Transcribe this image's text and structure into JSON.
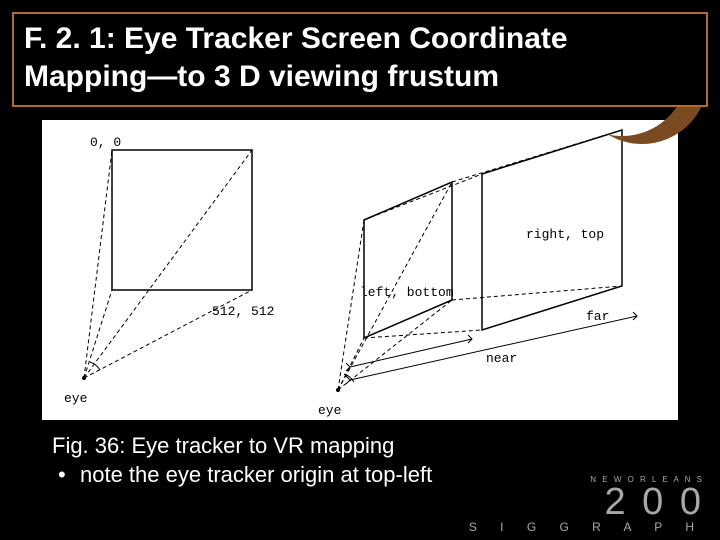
{
  "title": "F. 2. 1: Eye Tracker Screen Coordinate Mapping—to 3 D viewing frustum",
  "figure": {
    "left": {
      "origin_label": "0, 0",
      "extent_label": "512, 512",
      "eye_label": "eye"
    },
    "right": {
      "top_corner_label": "right, top",
      "bottom_corner_label": "left, bottom",
      "near_label": "near",
      "far_label": "far",
      "eye_label": "eye"
    }
  },
  "caption": {
    "line": "Fig. 36: Eye tracker to VR mapping",
    "bullet": "note the eye tracker origin at top-left"
  },
  "brand": {
    "city": "N E W   O R L E A N S",
    "year": "2 0 0 ",
    "name": "S I G G R A P H"
  },
  "colors": {
    "title_border": "#b36a2a",
    "crescent": "#7a4a20"
  }
}
